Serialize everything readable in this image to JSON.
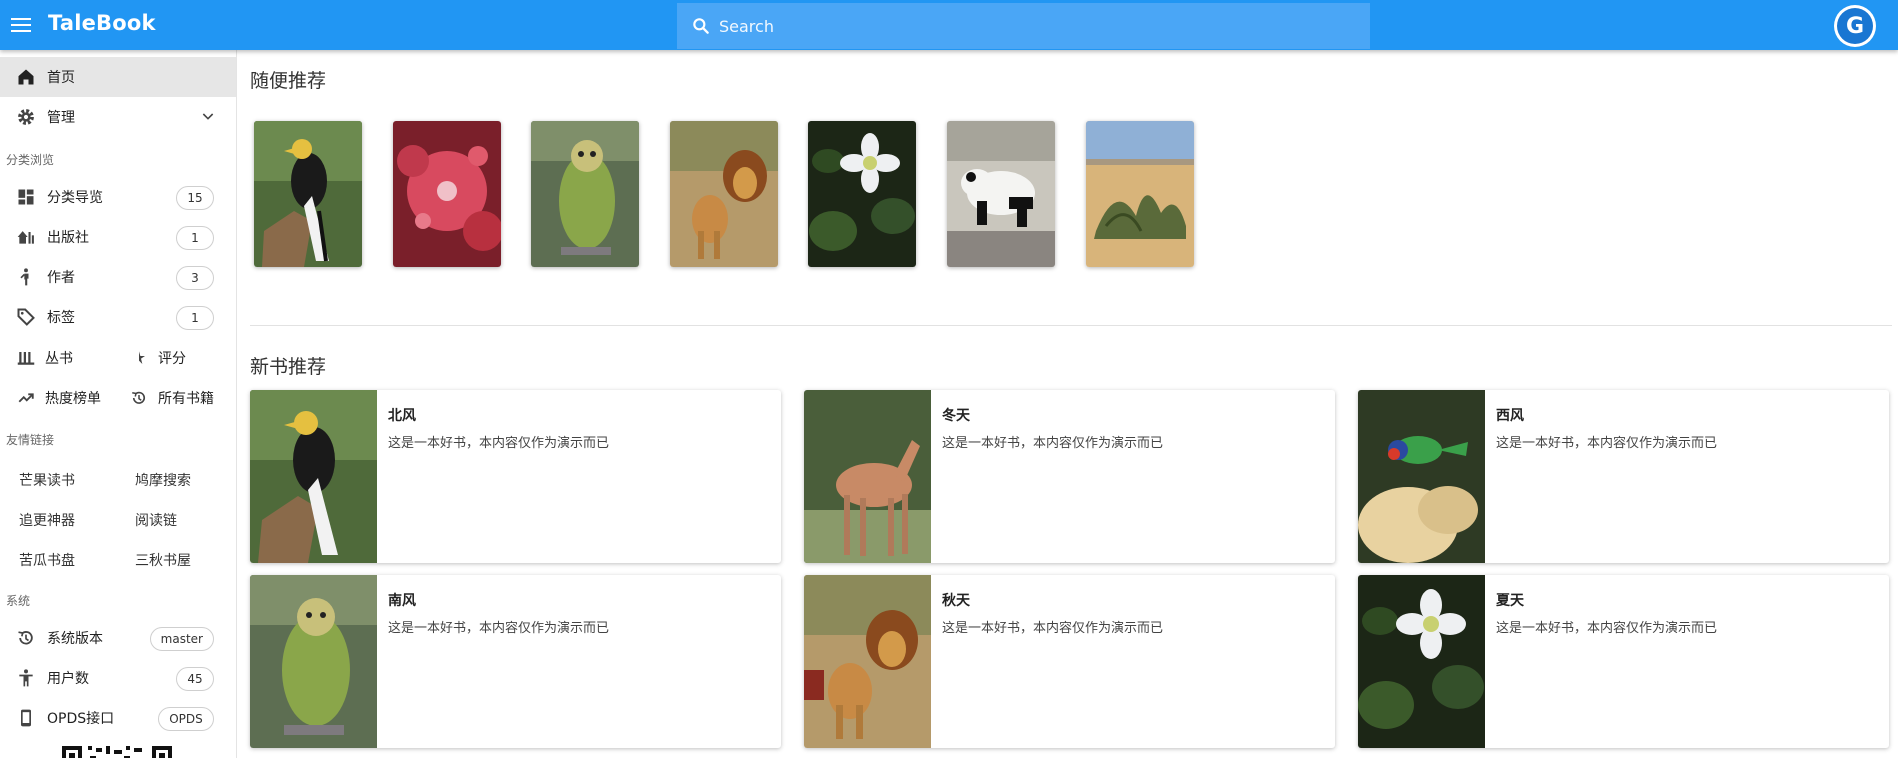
{
  "app": {
    "brand": "TaleBook",
    "search_placeholder": "Search",
    "avatar_letter": "G",
    "accent": "#2196f3"
  },
  "sidebar": {
    "home": "首页",
    "admin": "管理",
    "browse_header": "分类浏览",
    "categories": {
      "label": "分类导览",
      "count": "15"
    },
    "publishers": {
      "label": "出版社",
      "count": "1"
    },
    "authors": {
      "label": "作者",
      "count": "3"
    },
    "tags": {
      "label": "标签",
      "count": "1"
    },
    "series": "丛书",
    "rating": "评分",
    "hot": "热度榜单",
    "all_books": "所有书籍",
    "links_header": "友情链接",
    "links": [
      "芒果读书",
      "鸠摩搜索",
      "追更神器",
      "阅读链",
      "苦瓜书盘",
      "三秋书屋"
    ],
    "system_header": "系统",
    "version": {
      "label": "系统版本",
      "value": "master"
    },
    "users": {
      "label": "用户数",
      "value": "45"
    },
    "opds": {
      "label": "OPDS接口",
      "value": "OPDS"
    }
  },
  "main": {
    "random_title": "随便推荐",
    "random_covers": [
      "hornbill",
      "sundew",
      "kakapo",
      "lions",
      "white-flower",
      "panda",
      "desert-plant"
    ],
    "new_title": "新书推荐",
    "books": [
      {
        "title": "北风",
        "desc": "这是一本好书，本内容仅作为演示而已",
        "cover": "hornbill"
      },
      {
        "title": "冬天",
        "desc": "这是一本好书，本内容仅作为演示而已",
        "cover": "deer"
      },
      {
        "title": "西风",
        "desc": "这是一本好书，本内容仅作为演示而已",
        "cover": "lorikeet"
      },
      {
        "title": "南风",
        "desc": "这是一本好书，本内容仅作为演示而已",
        "cover": "kakapo"
      },
      {
        "title": "秋天",
        "desc": "这是一本好书，本内容仅作为演示而已",
        "cover": "lions"
      },
      {
        "title": "夏天",
        "desc": "这是一本好书，本内容仅作为演示而已",
        "cover": "white-flower"
      }
    ]
  }
}
